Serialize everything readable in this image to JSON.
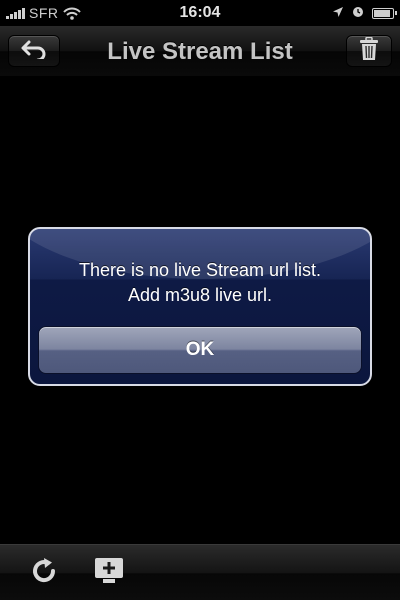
{
  "status_bar": {
    "carrier": "SFR",
    "time": "16:04",
    "battery_level": 0.9,
    "icons": [
      "signal-icon",
      "wifi-icon",
      "location-arrow-icon",
      "alarm-clock-icon",
      "battery-icon"
    ]
  },
  "nav_bar": {
    "title": "Live Stream List",
    "left_icon": "back-arrow-icon",
    "right_icon": "trash-icon"
  },
  "alert": {
    "line1": "There is no live Stream url list.",
    "line2": "Add m3u8 live url.",
    "button_label": "OK"
  },
  "toolbar": {
    "icons": [
      "refresh-icon",
      "add-stream-icon"
    ]
  },
  "colors": {
    "alert_background": "#172554",
    "alert_border": "#d8dbe6",
    "nav_text": "#c4c4c4"
  }
}
